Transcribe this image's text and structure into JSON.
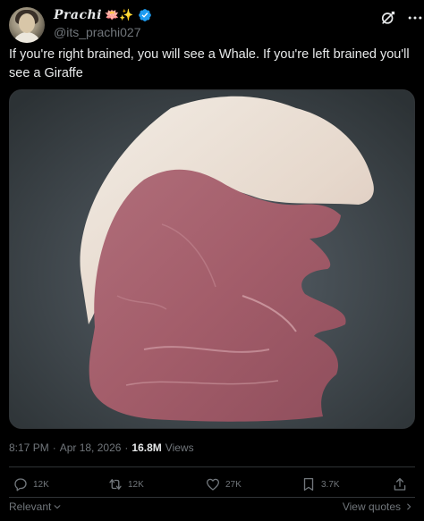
{
  "author": {
    "display_name": "Prachi",
    "name_emojis": "🪷✨",
    "handle": "@its_prachi027",
    "verified_icon": "verified-badge-icon"
  },
  "post": {
    "text": "If you're right brained, you will see a Whale. If you're left brained you'll see a Giraffe",
    "time": "8:17 PM",
    "separator": "·",
    "date": "Apr 18, 2026",
    "views_count": "16.8M",
    "views_label": "Views"
  },
  "actions": {
    "replies": "12K",
    "reposts": "12K",
    "likes": "27K",
    "bookmarks": "3.7K"
  },
  "footer": {
    "relevant_label": "Relevant",
    "view_quotes_label": "View quotes"
  },
  "colors": {
    "background": "#000000",
    "text_primary": "#e7e9ea",
    "text_secondary": "#71767b",
    "verified": "#1d9bf0",
    "divider": "#2f3336"
  }
}
